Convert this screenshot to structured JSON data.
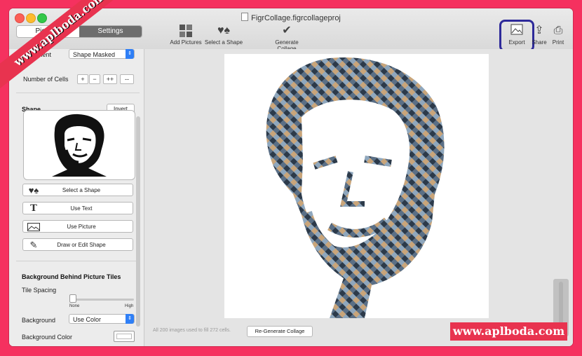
{
  "window": {
    "title": "FigrCollage.figrcollageproj"
  },
  "sidebar_tabs": {
    "pictures": "Pictures",
    "settings": "Settings"
  },
  "toolbar": {
    "add_pictures": "Add Pictures",
    "select_shape": "Select a Shape",
    "generate_collage": "Generate Collage",
    "export": "Export",
    "share": "Share",
    "print": "Print"
  },
  "settings": {
    "alignment_label": "Alignment",
    "alignment_value": "Shape Masked",
    "cells_label": "Number of Cells",
    "cell_buttons": [
      "+",
      "−",
      "++",
      "--"
    ],
    "shape_heading": "Shape",
    "invert": "Invert",
    "shape_buttons": [
      "Select a Shape",
      "Use Text",
      "Use Picture",
      "Draw or Edit Shape"
    ],
    "bg_heading": "Background Behind Picture Tiles",
    "tile_spacing_label": "Tile Spacing",
    "tile_spacing_min": "None",
    "tile_spacing_max": "High",
    "tile_spacing_value": 0,
    "background_label": "Background",
    "background_value": "Use Color",
    "background_color_label": "Background Color",
    "background_color": "#ffffff"
  },
  "main": {
    "status": "All 200 images used to fill 272 cells.",
    "regenerate": "Re-Generate Collage"
  },
  "watermark": {
    "text": "www.aplboda.com"
  },
  "colors": {
    "page_border": "#f5315f",
    "banner": "#e8334f",
    "highlight_ring": "#2e2a9a",
    "accent": "#2f7ff6"
  }
}
